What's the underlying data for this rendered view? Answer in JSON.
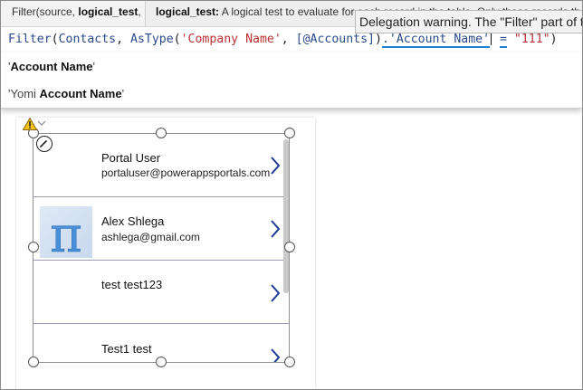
{
  "tabs": [
    {
      "prefix": "Filter(source, ",
      "bold": "logical_test",
      "suffix": ", ...)"
    },
    {
      "bold": "logical_test:",
      "suffix": " A logical test to evaluate for each record in the table. Only those records that will be included..."
    }
  ],
  "tooltip": {
    "text": "Delegation warning. The \"Filter\" part of this formula might not work correctly on large data sets."
  },
  "formula": {
    "fn": "Filter",
    "open": "(",
    "source": "Contacts",
    "sep1": ", ",
    "astype": "AsType",
    "open2": "(",
    "str1": "'Company Name'",
    "sep2": ", ",
    "ref": "[@Accounts]",
    "close2": ")",
    "dot": ".",
    "field": "'Account Name'",
    "space": " ",
    "eq": "=",
    "space2": " ",
    "str2": "\"111\"",
    "close": ")"
  },
  "dropdown": {
    "items": [
      {
        "pre": "'",
        "bold": "Account Name",
        "post": "'"
      },
      {
        "pre": "'Yomi ",
        "bold": "Account Name",
        "post": "'"
      }
    ]
  },
  "gallery": {
    "rows": [
      {
        "title": "Portal User",
        "subtitle": "portaluser@powerappsportals.com",
        "photo": false
      },
      {
        "title": "Alex Shlega",
        "subtitle": "ashlega@gmail.com",
        "photo": true
      },
      {
        "title": "test test123",
        "subtitle": "",
        "photo": false
      },
      {
        "title": "Test1 test",
        "subtitle": "",
        "photo": false
      }
    ]
  },
  "icons": {
    "warning": "warning-icon",
    "edit": "pencil-icon",
    "chevron_right": "chevron-right-icon",
    "chevron_down": "chevron-down-icon",
    "photo_glyph": "π"
  },
  "colors": {
    "string": "#b83232",
    "keyword": "#2a4a8a",
    "underline": "#1e7fd6",
    "warning": "#f4c21a"
  }
}
